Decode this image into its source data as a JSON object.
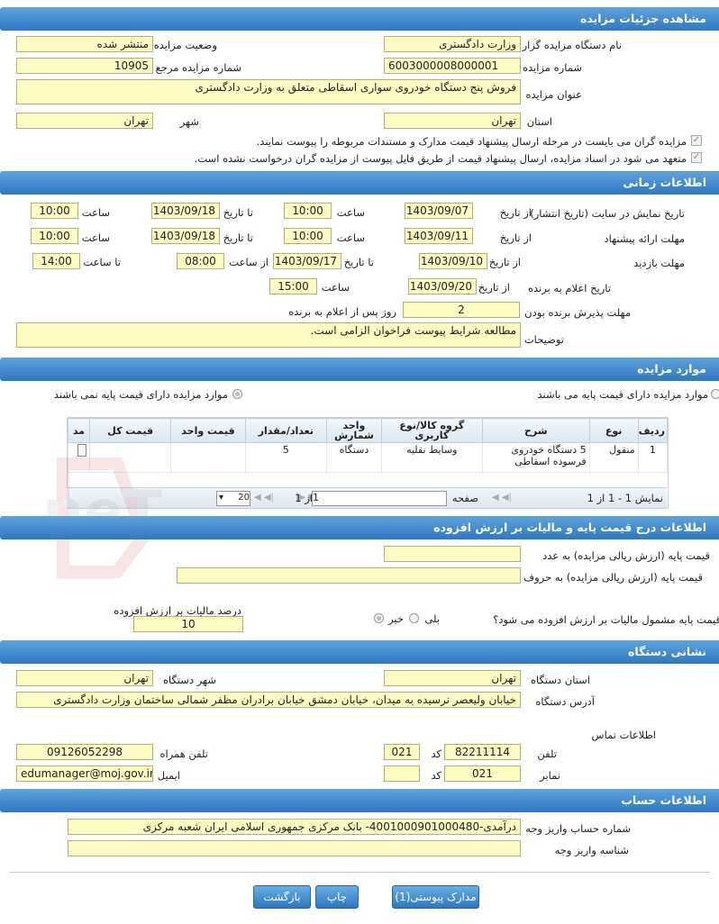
{
  "sections": {
    "details": "مشاهده جزئیات مزایده",
    "timing": "اطلاعات زمانی",
    "items": "موارد مزایده",
    "pricing": "اطلاعات درج قیمت پایه و مالیات بر ارزش افزوده",
    "address": "نشانی دستگاه",
    "account": "اطلاعات حساب"
  },
  "details": {
    "org_label": "نام دستگاه مزایده گزار",
    "org_value": "وزارت دادگستری",
    "status_label": "وضعیت مزایده",
    "status_value": "منتشر شده",
    "number_label": "شماره مزایده",
    "number_value": "6003000008000001",
    "ref_label": "شماره مزایده مرجع",
    "ref_value": "10905",
    "title_label": "عنوان مزایده",
    "title_value": "فروش پنج دستگاه خودروی سواری اسقاطی متعلق به وزارت دادگستری",
    "province_label": "استان",
    "province_value": "تهران",
    "city_label": "شهر",
    "city_value": "تهران",
    "check1": "مزایده گران می بایست در مرحله ارسال پیشنهاد قیمت مدارک و مستندات مربوطه را پیوست نمایند.",
    "check2": "متعهد می شود در اسناد مزایده، ارسال پیشنهاد قیمت از طریق فایل پیوست از مزایده گران درخواست نشده است."
  },
  "timing": {
    "display_label": "تاریخ نمایش در سایت (تاریخ انتشار)",
    "offer_label": "مهلت ارائه پیشنهاد",
    "visit_label": "مهلت بازدید",
    "announce_label": "تاریخ اعلام به برنده",
    "accept_label": "مهلت پذیرش برنده بودن",
    "notes_label": "توضیحات",
    "from_date": "از تاریخ",
    "to_date": "تا تاریخ",
    "time": "ساعت",
    "from_time": "از ساعت",
    "to_time": "تا ساعت",
    "display_from": "1403/09/07",
    "display_from_time": "10:00",
    "display_to": "1403/09/18",
    "display_to_time": "10:00",
    "offer_from": "1403/09/11",
    "offer_from_time": "10:00",
    "offer_to": "1403/09/18",
    "offer_to_time": "10:00",
    "visit_from": "1403/09/10",
    "visit_to": "1403/09/17",
    "visit_from_time": "08:00",
    "visit_to_time": "14:00",
    "announce_from": "1403/09/20",
    "announce_time": "15:00",
    "accept_days": "2",
    "accept_suffix": "روز پس از اعلام به برنده",
    "notes_value": "مطالعه شرایط پیوست فراخوان الزامی است."
  },
  "items": {
    "radio_with": "موارد مزایده دارای قیمت پایه می باشند",
    "radio_without": "موارد مزایده دارای قیمت پایه نمی باشند",
    "columns": [
      "ردیف",
      "نوع",
      "شرح",
      "گروه کالا/نوع کاربری",
      "واحد شمارش",
      "تعداد/مقدار",
      "قیمت واحد",
      "قیمت کل",
      "مد"
    ],
    "rows": [
      [
        "1",
        "منقول",
        "5 دستگاه خودروی فرسوده اسقاطی",
        "وسایط نقلیه",
        "دستگاه",
        "5",
        "",
        "",
        ""
      ]
    ],
    "pager_showing": "نمایش 1 - 1 از 1",
    "pager_page": "صفحه",
    "pager_page_value": "1",
    "pager_of": "از 1",
    "pager_size": "20"
  },
  "pricing": {
    "base_num_label": "قیمت پایه (ارزش ریالی مزایده) به عدد",
    "base_text_label": "قیمت پایه (ارزش ریالی مزایده) به حروف",
    "vat_question": "قیمت پایه مشمول مالیات بر ارزش افزوده می شود؟",
    "yes": "بلی",
    "no": "خیر",
    "vat_percent_label": "درصد مالیات بر ارزش افزوده",
    "vat_percent_value": "10"
  },
  "address": {
    "province_label": "استان دستگاه",
    "province_value": "تهران",
    "city_label": "شهر دستگاه",
    "city_value": "تهران",
    "addr_label": "آدرس دستگاه",
    "addr_value": "خیابان ولیعصر نرسیده به میدان، خیابان دمشق خیابان برادران مظفر شمالی ساختمان وزارت دادگستری",
    "contact_label": "اطلاعات تماس",
    "phone_label": "تلفن",
    "phone_value": "82211114",
    "code_label": "کد",
    "phone_code": "021",
    "mobile_label": "تلفن همراه",
    "mobile_value": "09126052298",
    "fax_label": "نمابر",
    "fax_value": "021",
    "fax_code": "",
    "email_label": "ایمیل",
    "email_value": "edumanager@moj.gov.ir"
  },
  "account": {
    "acct_label": "شماره حساب واریز وجه",
    "acct_value": "درآمدی-4001000901000480- بانک مرکزی جمهوری اسلامی ایران شعبه مرکزی",
    "id_label": "شناسه واریز وجه",
    "id_value": ""
  },
  "buttons": {
    "attachments": "مدارک پیوستی(1)",
    "print": "چاپ",
    "back": "بازگشت"
  },
  "watermark": "AriaTender.neT"
}
